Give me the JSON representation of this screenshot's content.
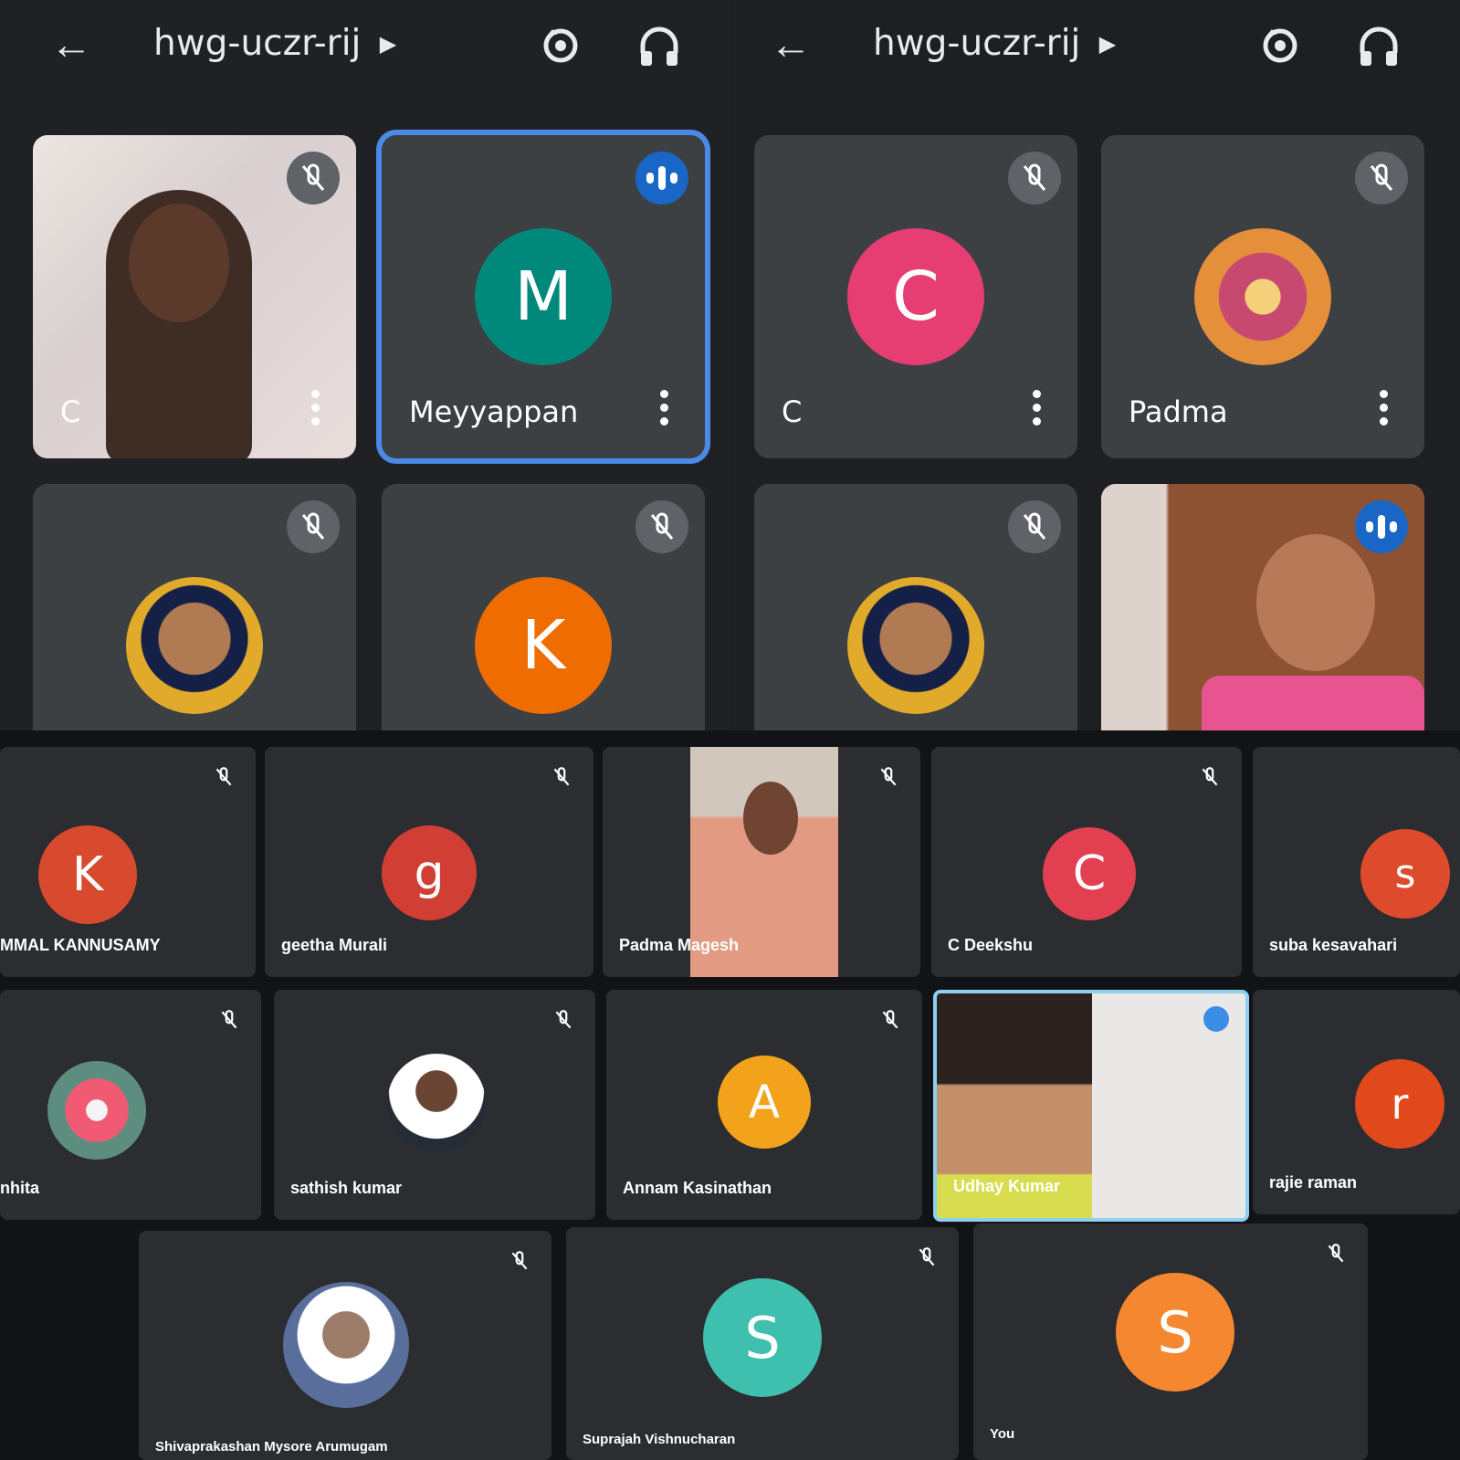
{
  "left_phone": {
    "meeting_code": "hwg-uczr-rij",
    "tiles": [
      {
        "name": "C"
      },
      {
        "name": "Meyyappan",
        "initial": "M",
        "color": "#00897b"
      },
      {
        "name": ""
      },
      {
        "name": "",
        "initial": "K",
        "color": "#ef6c00"
      }
    ]
  },
  "right_phone": {
    "meeting_code": "hwg-uczr-rij",
    "tiles": [
      {
        "name": "C",
        "initial": "C",
        "color": "#e63d73"
      },
      {
        "name": "Padma"
      },
      {
        "name": ""
      },
      {
        "name": ""
      }
    ]
  },
  "desktop_grid": {
    "rows": [
      [
        {
          "name": "MMAL KANNUSAMY",
          "initial": "K",
          "color": "#d84a2d"
        },
        {
          "name": "geetha Murali",
          "initial": "g",
          "color": "#d13e34"
        },
        {
          "name": "Padma Magesh"
        },
        {
          "name": "C Deekshu",
          "initial": "C",
          "color": "#e24051"
        },
        {
          "name": "suba kesavahari",
          "initial": "s",
          "color": "#de4b2c"
        }
      ],
      [
        {
          "name": "nhita"
        },
        {
          "name": "sathish kumar"
        },
        {
          "name": "Annam Kasinathan",
          "initial": "A",
          "color": "#f3a21b"
        },
        {
          "name": "Udhay Kumar"
        },
        {
          "name": "rajie raman",
          "initial": "r",
          "color": "#e1491c"
        }
      ],
      [
        {
          "name": "Shivaprakashan Mysore Arumugam"
        },
        {
          "name": "Suprajah Vishnucharan",
          "initial": "S",
          "color": "#3fbfae"
        },
        {
          "name": "You",
          "initial": "S",
          "color": "#f58730"
        }
      ]
    ]
  },
  "colors": {
    "active_border": "#4a8ae6",
    "speaking_badge": "#1a66c7",
    "muted_badge": "#5f6368"
  }
}
